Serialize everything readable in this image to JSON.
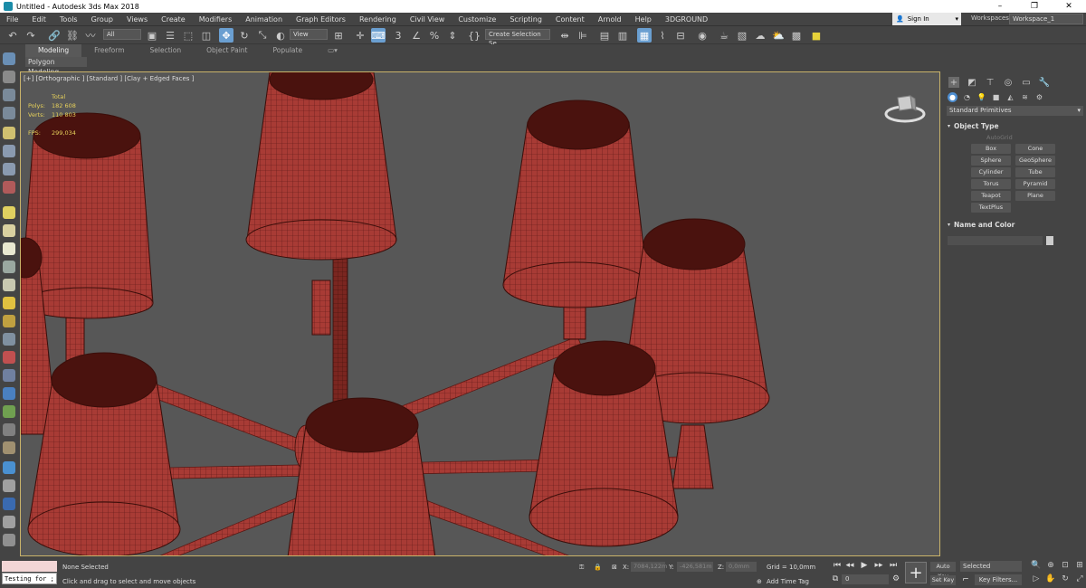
{
  "titlebar": {
    "title": "Untitled - Autodesk 3ds Max 2018"
  },
  "menu": [
    "File",
    "Edit",
    "Tools",
    "Group",
    "Views",
    "Create",
    "Modifiers",
    "Animation",
    "Graph Editors",
    "Rendering",
    "Civil View",
    "Customize",
    "Scripting",
    "Content",
    "Arnold",
    "Help",
    "3DGROUND"
  ],
  "account": {
    "signin": "Sign In",
    "workspaces_label": "Workspaces:",
    "workspace": "Workspace_1"
  },
  "toolbar": {
    "filter": "All",
    "ref_coord": "View",
    "selection_set": "Create Selection Se"
  },
  "ribbon": {
    "tabs": [
      "Modeling",
      "Freeform",
      "Selection",
      "Object Paint",
      "Populate"
    ],
    "panel_label": "Polygon Modeling"
  },
  "viewport": {
    "label": "[+] [Orthographic ] [Standard ] [Clay + Edged Faces ]",
    "stats": {
      "total_label": "Total",
      "polys_label": "Polys:",
      "polys": "182 608",
      "verts_label": "Verts:",
      "verts": "110 803",
      "fps_label": "FPS:",
      "fps": "299,034"
    }
  },
  "command_panel": {
    "category": "Standard Primitives",
    "object_type_title": "Object Type",
    "autogrid": "AutoGrid",
    "primitives": [
      "Box",
      "Cone",
      "Sphere",
      "GeoSphere",
      "Cylinder",
      "Tube",
      "Torus",
      "Pyramid",
      "Teapot",
      "Plane",
      "TextPlus"
    ],
    "name_color_title": "Name and Color"
  },
  "status": {
    "script_input": "Testing for ;",
    "selection": "None Selected",
    "prompt": "Click and drag to select and move objects",
    "x_label": "X:",
    "x": "7084,122m",
    "y_label": "Y:",
    "y": "-426,581m",
    "z_label": "Z:",
    "z": "0,0mm",
    "grid": "Grid = 10,0mm",
    "add_time_tag": "Add Time Tag",
    "frame": "0",
    "auto_key": "Auto Key",
    "set_key": "Set Key",
    "selected": "Selected",
    "key_filters": "Key Filters..."
  }
}
